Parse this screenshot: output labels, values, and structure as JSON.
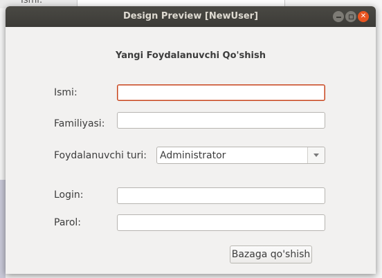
{
  "background": {
    "field_label": "Ismi:"
  },
  "window": {
    "title": "Design Preview [NewUser]"
  },
  "form": {
    "heading": "Yangi Foydalanuvchi Qo'shish",
    "first_name": {
      "label": "Ismi:",
      "value": ""
    },
    "last_name": {
      "label": "Familiyasi:",
      "value": ""
    },
    "user_type": {
      "label": "Foydalanuvchi turi:",
      "selected": "Administrator"
    },
    "login": {
      "label": "Login:",
      "value": ""
    },
    "password": {
      "label": "Parol:",
      "value": ""
    },
    "submit_label": "Bazaga qo'shish"
  },
  "colors": {
    "titlebar": "#3c3b37",
    "close_button": "#e95420",
    "focus_border": "#c7431b",
    "window_bg": "#f2f1f0"
  }
}
